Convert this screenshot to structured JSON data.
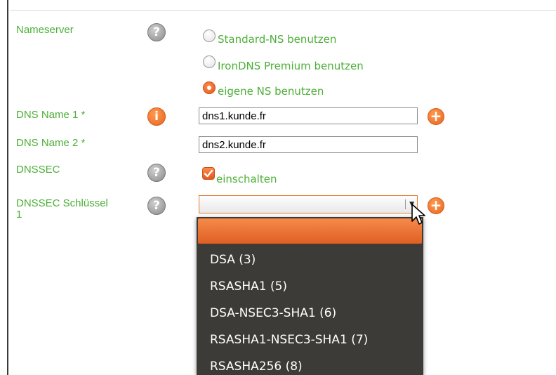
{
  "form": {
    "nameserver": {
      "label": "Nameserver",
      "options": [
        {
          "label": "Standard-NS benutzen",
          "checked": false
        },
        {
          "label": "IronDNS Premium benutzen",
          "checked": false
        },
        {
          "label": "eigene NS benutzen",
          "checked": true
        }
      ]
    },
    "dns_name_1": {
      "label": "DNS Name 1 *",
      "value": "dns1.kunde.fr"
    },
    "dns_name_2": {
      "label": "DNS Name 2 *",
      "value": "dns2.kunde.fr"
    },
    "dnssec": {
      "label": "DNSSEC",
      "checkbox_label": "einschalten",
      "checked": true
    },
    "dnssec_key_1": {
      "label_line1": "DNSSEC Schlüssel",
      "label_line2": "1",
      "selected_value": "",
      "options": [
        "",
        "DSA (3)",
        "RSASHA1 (5)",
        "DSA-NSEC3-SHA1 (6)",
        "RSASHA1-NSEC3-SHA1 (7)",
        "RSASHA256 (8)"
      ]
    }
  },
  "icons": {
    "help": "?",
    "info": "i",
    "plus": "+"
  },
  "colors": {
    "label_green": "#4caf37",
    "accent_orange": "#e8661e",
    "dropdown_bg": "#3c3b37"
  }
}
